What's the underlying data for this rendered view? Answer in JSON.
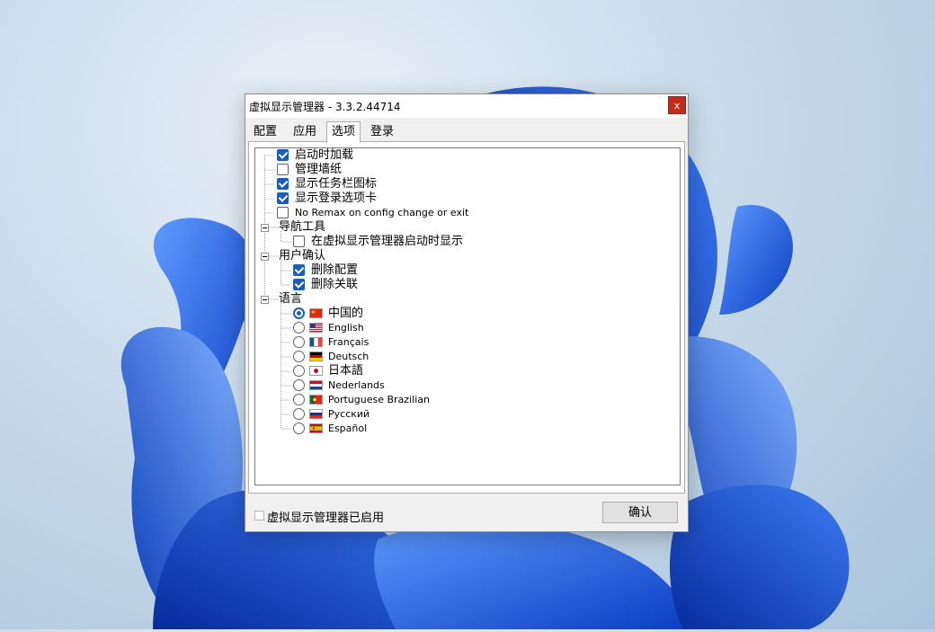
{
  "window": {
    "title": "虚拟显示管理器 - 3.3.2.44714",
    "close_glyph": "x"
  },
  "tabs": [
    {
      "label": "配置",
      "active": false
    },
    {
      "label": "应用",
      "active": false
    },
    {
      "label": "选项",
      "active": true
    },
    {
      "label": "登录",
      "active": false
    }
  ],
  "options": {
    "startup_load": {
      "label": "启动时加载",
      "checked": true
    },
    "manage_wallpaper": {
      "label": "管理墙纸",
      "checked": false
    },
    "taskbar_icon": {
      "label": "显示任务栏图标",
      "checked": true
    },
    "login_tab": {
      "label": "显示登录选项卡",
      "checked": true
    },
    "no_remax": {
      "label": "No Remax on config change or exit",
      "checked": false
    }
  },
  "nav_tools": {
    "label": "导航工具",
    "show_on_start": {
      "label": "在虚拟显示管理器启动时显示",
      "checked": false
    }
  },
  "user_confirm": {
    "label": "用户确认",
    "delete_config": {
      "label": "删除配置",
      "checked": true
    },
    "delete_association": {
      "label": "删除关联",
      "checked": true
    }
  },
  "language": {
    "label": "语言",
    "selected": "中国的",
    "items": [
      {
        "label": "中国的",
        "flag": "cn-flag-icon"
      },
      {
        "label": "English",
        "flag": "us-flag-icon"
      },
      {
        "label": "Français",
        "flag": "fr-flag-icon"
      },
      {
        "label": "Deutsch",
        "flag": "de-flag-icon"
      },
      {
        "label": "日本語",
        "flag": "jp-flag-icon"
      },
      {
        "label": "Nederlands",
        "flag": "nl-flag-icon"
      },
      {
        "label": "Portuguese Brazilian",
        "flag": "pt-flag-icon"
      },
      {
        "label": "Русский",
        "flag": "ru-flag-icon"
      },
      {
        "label": "Español",
        "flag": "es-flag-icon"
      }
    ]
  },
  "footer": {
    "enabled_label": "虚拟显示管理器已启用",
    "enabled_checked": false,
    "ok_label": "确认"
  },
  "colors": {
    "accent": "#1a5fb4",
    "close": "#c42b1c",
    "wallpaper_bloom": "#1f5fe0"
  }
}
